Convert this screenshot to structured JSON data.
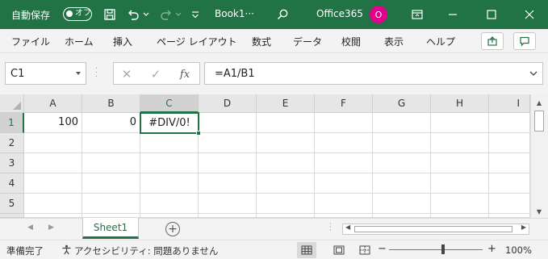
{
  "titlebar": {
    "autosave_label": "自動保存",
    "autosave_state": "オフ",
    "doc_title": "Book1···",
    "account": "Office365",
    "avatar_initial": "O",
    "bg_color": "#217346"
  },
  "ribbon": {
    "tabs": [
      "ファイル",
      "ホーム",
      "挿入",
      "ページ レイアウト",
      "数式",
      "データ",
      "校閲",
      "表示",
      "ヘルプ"
    ]
  },
  "formula_bar": {
    "name_box": "C1",
    "fx_label": "fx",
    "formula": "=A1/B1"
  },
  "grid": {
    "columns": [
      "A",
      "B",
      "C",
      "D",
      "E",
      "F",
      "G",
      "H",
      "I"
    ],
    "rows": [
      "1",
      "2",
      "3",
      "4",
      "5"
    ],
    "selected_column": "C",
    "selected_row": "1",
    "cells": {
      "A1": "100",
      "B1": "0",
      "C1": "#DIV/0!"
    }
  },
  "sheets": {
    "tabs": [
      "Sheet1"
    ],
    "active": "Sheet1"
  },
  "statusbar": {
    "ready": "準備完了",
    "accessibility": "アクセシビリティ: 問題ありません",
    "zoom_minus": "−",
    "zoom_plus": "+",
    "zoom": "100%"
  },
  "colors": {
    "accent": "#217346",
    "avatar": "#e3008c"
  }
}
